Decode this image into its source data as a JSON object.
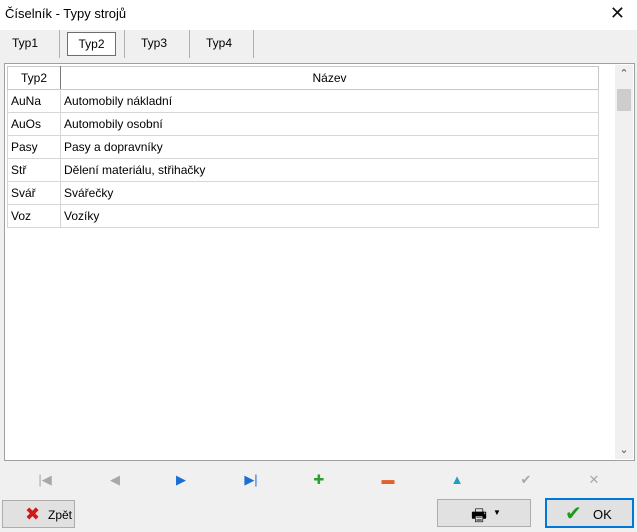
{
  "window": {
    "title": "Číselník - Typy strojů",
    "close_glyph": "✕"
  },
  "tabs": [
    {
      "label": "Typ1",
      "active": false
    },
    {
      "label": "Typ2",
      "active": true
    },
    {
      "label": "Typ3",
      "active": false
    },
    {
      "label": "Typ4",
      "active": false
    }
  ],
  "grid": {
    "columns": [
      "Typ2",
      "Název"
    ],
    "rows": [
      [
        "AuNa",
        "Automobily nákladní"
      ],
      [
        "AuOs",
        "Automobily osobní"
      ],
      [
        "Pasy",
        "Pasy a dopravníky"
      ],
      [
        "Stř",
        "Dělení materiálu, střihačky"
      ],
      [
        "Svář",
        "Svářečky"
      ],
      [
        "Voz",
        "Vozíky"
      ]
    ],
    "scroll_up": "⌃",
    "scroll_down": "⌄"
  },
  "navigator": [
    {
      "name": "first-record-icon",
      "glyph": "|◀",
      "color": "#a8a8a8"
    },
    {
      "name": "prior-record-icon",
      "glyph": "◀",
      "color": "#a8a8a8"
    },
    {
      "name": "next-record-icon",
      "glyph": "▶",
      "color": "#1a6fd6"
    },
    {
      "name": "last-record-icon",
      "glyph": "▶|",
      "color": "#1a6fd6"
    },
    {
      "name": "insert-record-icon",
      "glyph": "✚",
      "color": "#2e9e2e"
    },
    {
      "name": "delete-record-icon",
      "glyph": "▬",
      "color": "#e0622b"
    },
    {
      "name": "edit-record-icon",
      "glyph": "▲",
      "color": "#1aa0c8"
    },
    {
      "name": "post-record-icon",
      "glyph": "✔",
      "color": "#a8a8a8"
    },
    {
      "name": "cancel-record-icon",
      "glyph": "✕",
      "color": "#a8a8a8"
    }
  ],
  "footer": {
    "back_label": "Zpět",
    "back_icon": "✖",
    "print_icon": "🖶",
    "print_caret": "▼",
    "ok_label": "OK",
    "ok_icon": "✔"
  }
}
